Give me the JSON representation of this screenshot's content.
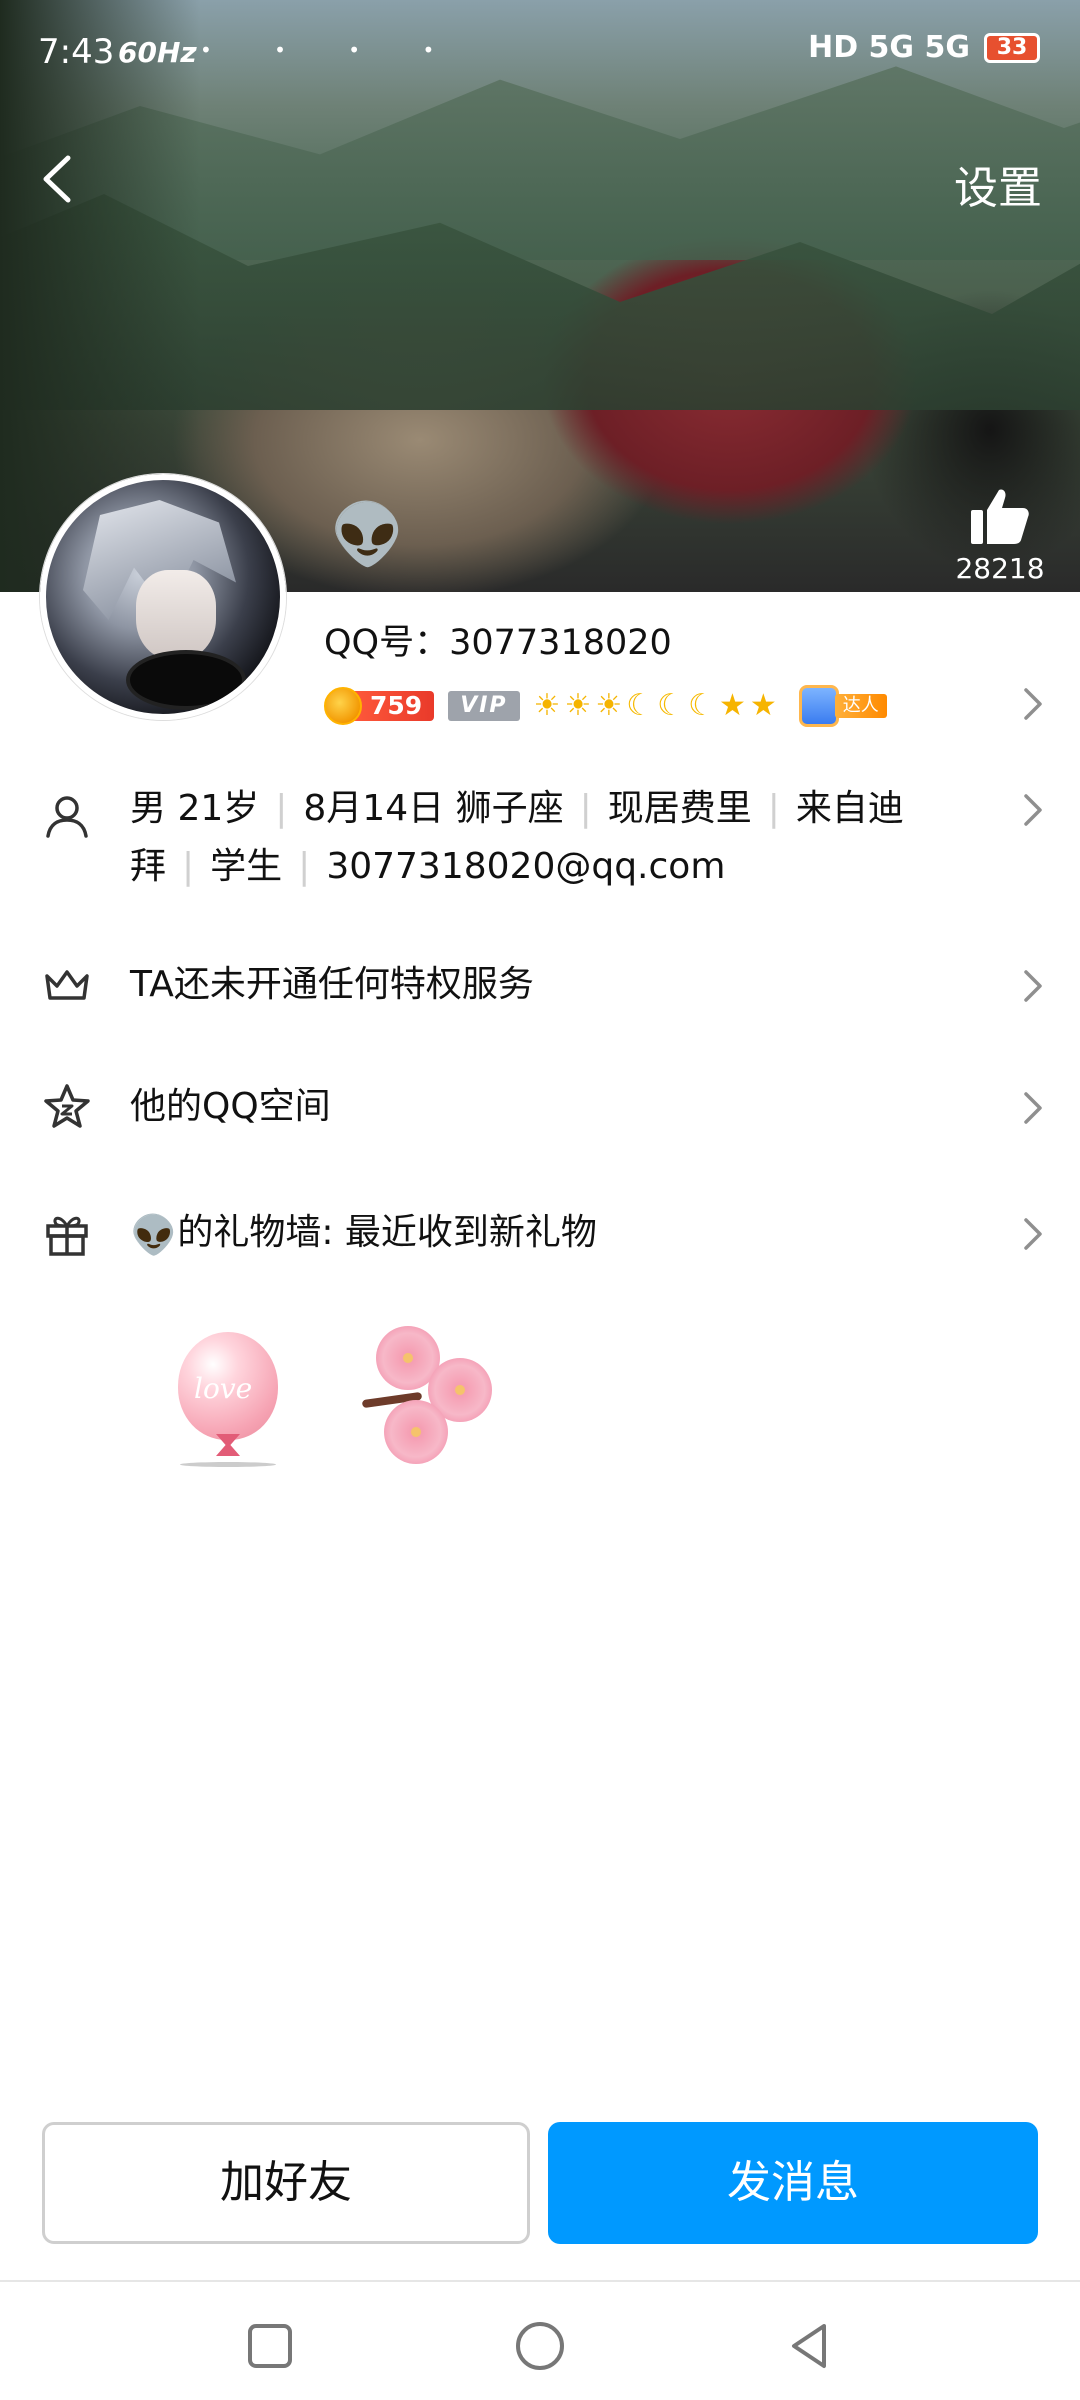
{
  "status_bar": {
    "time": "7:43",
    "refresh_rate": "60Hz",
    "notification_icons": "• • • •",
    "network": "HD 5G 5G",
    "battery": "33"
  },
  "header": {
    "settings_label": "设置",
    "like_count": "28218"
  },
  "profile": {
    "qq_number_label": "QQ号：3077318020",
    "level_number": "759",
    "vip_label": "VIP",
    "level_icons": [
      "☀",
      "☀",
      "☀",
      "☾",
      "☾",
      "☾",
      "★",
      "★"
    ],
    "daren_label": "达人",
    "avatar_badge": "👽"
  },
  "info": {
    "items": [
      "男  21岁",
      "8月14日  狮子座",
      "现居费里",
      "来自迪拜",
      "学生",
      "3077318020@qq.com"
    ],
    "line1": [
      "男  21岁",
      "8月14日  狮子座",
      "现居费里",
      "来自迪"
    ],
    "line2": [
      "拜",
      "学生",
      "3077318020@qq.com"
    ]
  },
  "rows": {
    "privilege": "TA还未开通任何特权服务",
    "qzone": "他的QQ空间",
    "gift_wall_icon": "👽",
    "gift_wall": "的礼物墙: 最近收到新礼物"
  },
  "gifts": {
    "balloon_text": "love"
  },
  "actions": {
    "add_friend": "加好友",
    "send_message": "发消息"
  },
  "colors": {
    "primary": "#0099ff",
    "level_badge": "#e93a2a",
    "vip_badge": "#9ea3ab"
  }
}
